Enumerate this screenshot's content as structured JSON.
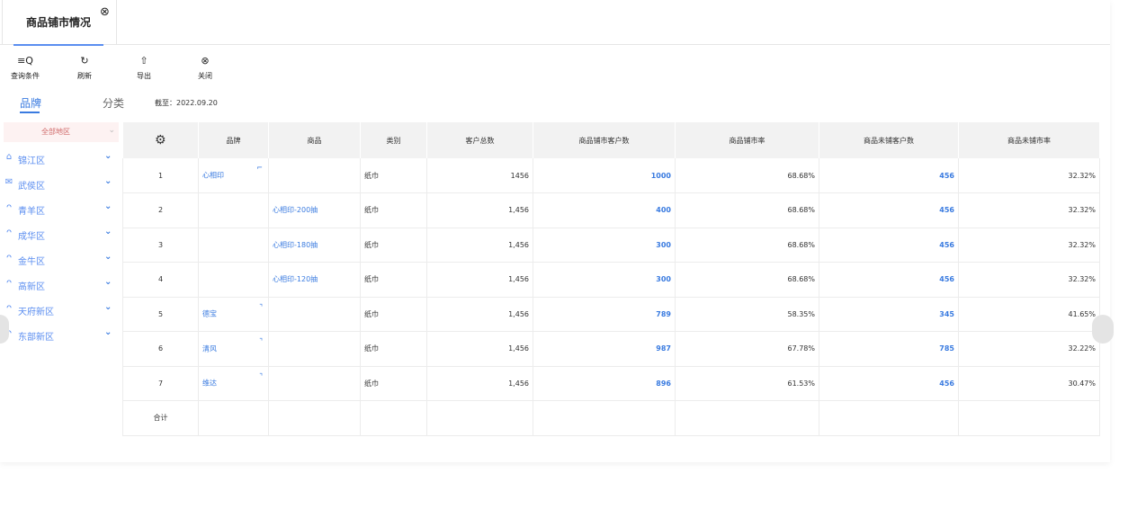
{
  "tab": {
    "title": "商品铺市情况",
    "close_icon": "close-circle-icon"
  },
  "toolbar": [
    {
      "icon": "≡Q",
      "icon_name": "query-icon",
      "label": "查询条件"
    },
    {
      "icon": "↻",
      "icon_name": "refresh-icon",
      "label": "刷新"
    },
    {
      "icon": "⇧",
      "icon_name": "export-icon",
      "label": "导出"
    },
    {
      "icon": "⊗",
      "icon_name": "close-circle-icon",
      "label": "关闭"
    }
  ],
  "subtabs": {
    "brand": "品牌",
    "category": "分类"
  },
  "as_of": "截至：2022.09.20",
  "sidebar": {
    "all_regions": "全部地区",
    "items": [
      {
        "label": "锦江区",
        "icon": "⌂",
        "icon_name": "home-icon"
      },
      {
        "label": "武侯区",
        "icon": "✉",
        "icon_name": "mail-icon"
      },
      {
        "label": "青羊区",
        "icon": "ᴖ",
        "icon_name": "user-icon"
      },
      {
        "label": "成华区",
        "icon": "ᴖ",
        "icon_name": "user-icon"
      },
      {
        "label": "金牛区",
        "icon": "ᴖ",
        "icon_name": "user-icon"
      },
      {
        "label": "高新区",
        "icon": "ᴖ",
        "icon_name": "user-icon"
      },
      {
        "label": "天府新区",
        "icon": "ᴖ",
        "icon_name": "user-icon"
      },
      {
        "label": "东部新区",
        "icon": "ᴖ",
        "icon_name": "user-icon"
      }
    ]
  },
  "table": {
    "headers": [
      "",
      "品牌",
      "商品",
      "类别",
      "客户总数",
      "商品铺市客户数",
      "商品铺市率",
      "商品未铺客户数",
      "商品未铺市率"
    ],
    "rows": [
      {
        "idx": "1",
        "brand": "心相印",
        "expand": "collapse",
        "product": "",
        "cat": "纸巾",
        "total": "1456",
        "covered": "1000",
        "rate": "68.68%",
        "uncovered": "456",
        "unrate": "32.32%"
      },
      {
        "idx": "2",
        "brand": "",
        "expand": "",
        "product": "心相印-200抽",
        "cat": "纸巾",
        "total": "1,456",
        "covered": "400",
        "rate": "68.68%",
        "uncovered": "456",
        "unrate": "32.32%"
      },
      {
        "idx": "3",
        "brand": "",
        "expand": "",
        "product": "心相印-180抽",
        "cat": "纸巾",
        "total": "1,456",
        "covered": "300",
        "rate": "68.68%",
        "uncovered": "456",
        "unrate": "32.32%"
      },
      {
        "idx": "4",
        "brand": "",
        "expand": "",
        "product": "心相印-120抽",
        "cat": "纸巾",
        "total": "1,456",
        "covered": "300",
        "rate": "68.68%",
        "uncovered": "456",
        "unrate": "32.32%"
      },
      {
        "idx": "5",
        "brand": "德宝",
        "expand": "expand",
        "product": "",
        "cat": "纸巾",
        "total": "1,456",
        "covered": "789",
        "rate": "58.35%",
        "uncovered": "345",
        "unrate": "41.65%"
      },
      {
        "idx": "6",
        "brand": "清风",
        "expand": "expand",
        "product": "",
        "cat": "纸巾",
        "total": "1,456",
        "covered": "987",
        "rate": "67.78%",
        "uncovered": "785",
        "unrate": "32.22%"
      },
      {
        "idx": "7",
        "brand": "维达",
        "expand": "expand",
        "product": "",
        "cat": "纸巾",
        "total": "1,456",
        "covered": "896",
        "rate": "61.53%",
        "uncovered": "456",
        "unrate": "30.47%"
      }
    ],
    "total_label": "合计"
  }
}
